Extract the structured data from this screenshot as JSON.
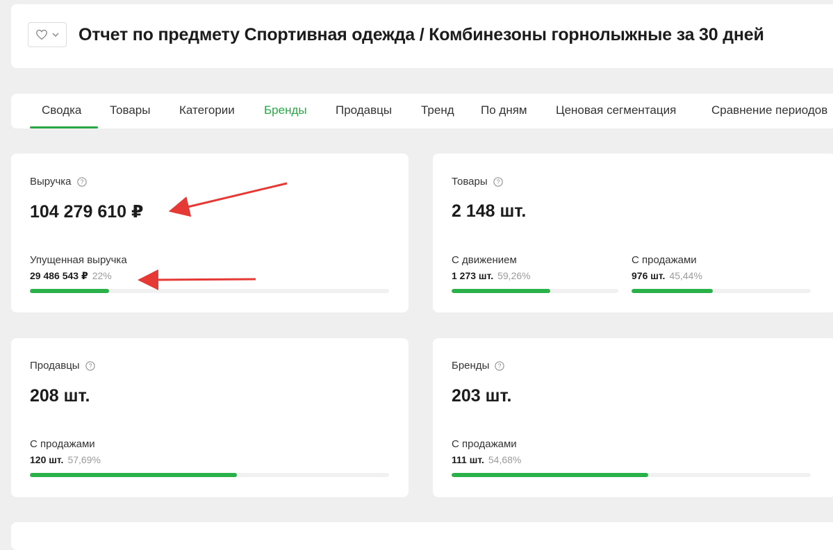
{
  "header": {
    "title": "Отчет по предмету Спортивная одежда / Комбинезоны горнолыжные за 30 дней"
  },
  "tabs": [
    {
      "label": "Сводка"
    },
    {
      "label": "Товары"
    },
    {
      "label": "Категории"
    },
    {
      "label": "Бренды"
    },
    {
      "label": "Продавцы"
    },
    {
      "label": "Тренд"
    },
    {
      "label": "По дням"
    },
    {
      "label": "Ценовая сегментация"
    },
    {
      "label": "Сравнение периодов"
    }
  ],
  "revenue": {
    "label": "Выручка",
    "value": "104 279 610 ₽",
    "lost_label": "Упущенная выручка",
    "lost_value": "29 486 543 ₽",
    "lost_pct": "22%",
    "lost_fraction": 0.22
  },
  "products": {
    "label": "Товары",
    "value": "2 148 шт.",
    "moving_label": "С движением",
    "moving_value": "1 273 шт.",
    "moving_pct": "59,26%",
    "moving_fraction": 0.5926,
    "sales_label": "С продажами",
    "sales_value": "976 шт.",
    "sales_pct": "45,44%",
    "sales_fraction": 0.4544
  },
  "sellers": {
    "label": "Продавцы",
    "value": "208 шт.",
    "sales_label": "С продажами",
    "sales_value": "120 шт.",
    "sales_pct": "57,69%",
    "sales_fraction": 0.5769
  },
  "brands": {
    "label": "Бренды",
    "value": "203 шт.",
    "sales_label": "С продажами",
    "sales_value": "111 шт.",
    "sales_pct": "54,68%",
    "sales_fraction": 0.5468
  },
  "colors": {
    "accent": "#27a844",
    "bar": "#2bb14a",
    "arrow": "#e53935"
  }
}
